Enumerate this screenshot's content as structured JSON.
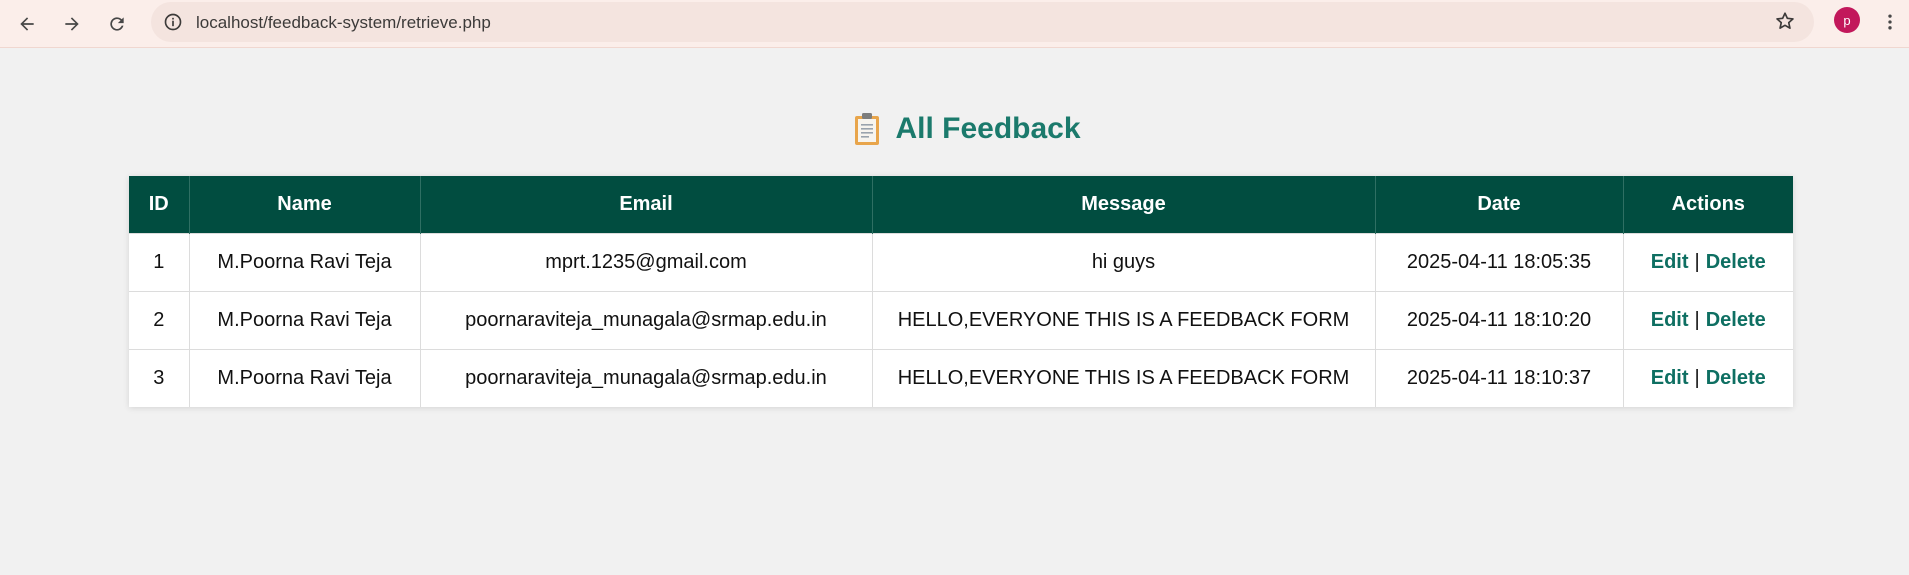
{
  "browser": {
    "url": "localhost/feedback-system/retrieve.php",
    "profile_initial": "p"
  },
  "page": {
    "title": "All Feedback"
  },
  "table": {
    "headers": {
      "id": "ID",
      "name": "Name",
      "email": "Email",
      "message": "Message",
      "date": "Date",
      "actions": "Actions"
    },
    "rows": [
      {
        "id": "1",
        "name": "M.Poorna Ravi Teja",
        "email": "mprt.1235@gmail.com",
        "message": "hi guys",
        "date": "2025-04-11 18:05:35"
      },
      {
        "id": "2",
        "name": "M.Poorna Ravi Teja",
        "email": "poornaraviteja_munagala@srmap.edu.in",
        "message": "HELLO,EVERYONE THIS IS A FEEDBACK FORM",
        "date": "2025-04-11 18:10:20"
      },
      {
        "id": "3",
        "name": "M.Poorna Ravi Teja",
        "email": "poornaraviteja_munagala@srmap.edu.in",
        "message": "HELLO,EVERYONE THIS IS A FEEDBACK FORM",
        "date": "2025-04-11 18:10:37"
      }
    ],
    "edit_label": "Edit",
    "separator": "|",
    "delete_label": "Delete"
  },
  "colors": {
    "header_bg": "#014d40",
    "title": "#1b7a6c",
    "link": "#0e6f62",
    "avatar": "#c2185b"
  }
}
